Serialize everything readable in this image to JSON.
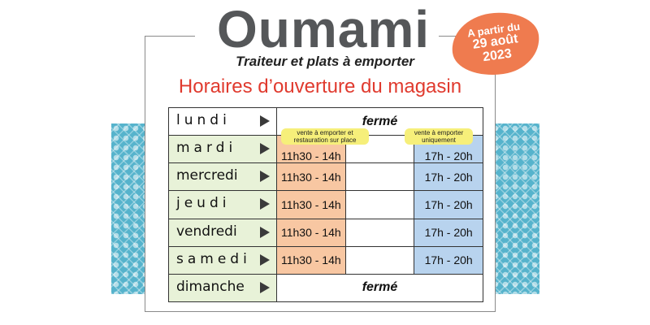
{
  "brand": {
    "name": "Oumami",
    "tagline": "Traiteur et plats à emporter"
  },
  "badge": {
    "line1": "A partir du",
    "line2": "29 août",
    "line3": "2023"
  },
  "heading": "Horaires d’ouverture du magasin",
  "notes": {
    "noon": "vente à emporter et restauration sur place",
    "evening": "vente à emporter uniquement"
  },
  "schedule": [
    {
      "day": "lundi",
      "closed": "fermé"
    },
    {
      "day": "mardi",
      "noon": "11h30 - 14h",
      "evening": "17h - 20h"
    },
    {
      "day": "mercredi",
      "noon": "11h30 - 14h",
      "evening": "17h - 20h"
    },
    {
      "day": "jeudi",
      "noon": "11h30 - 14h",
      "evening": "17h - 20h"
    },
    {
      "day": "vendredi",
      "noon": "11h30 - 14h",
      "evening": "17h - 20h"
    },
    {
      "day": "samedi",
      "noon": "11h30 - 14h",
      "evening": "17h - 20h"
    },
    {
      "day": "dimanche",
      "closed": "fermé"
    }
  ],
  "colors": {
    "title_gray": "#555759",
    "heading_red": "#e03a2e",
    "badge_orange": "#ef7b4f",
    "noon_orange": "#f8c7a2",
    "evening_blue": "#b8d3ee",
    "day_green": "#e8f2d8",
    "pattern_teal": "#56b3cc",
    "note_yellow": "#f6ef7a"
  },
  "icons": {
    "day_arrow": "play-triangle-icon",
    "side_pattern": "geometric-pattern"
  }
}
